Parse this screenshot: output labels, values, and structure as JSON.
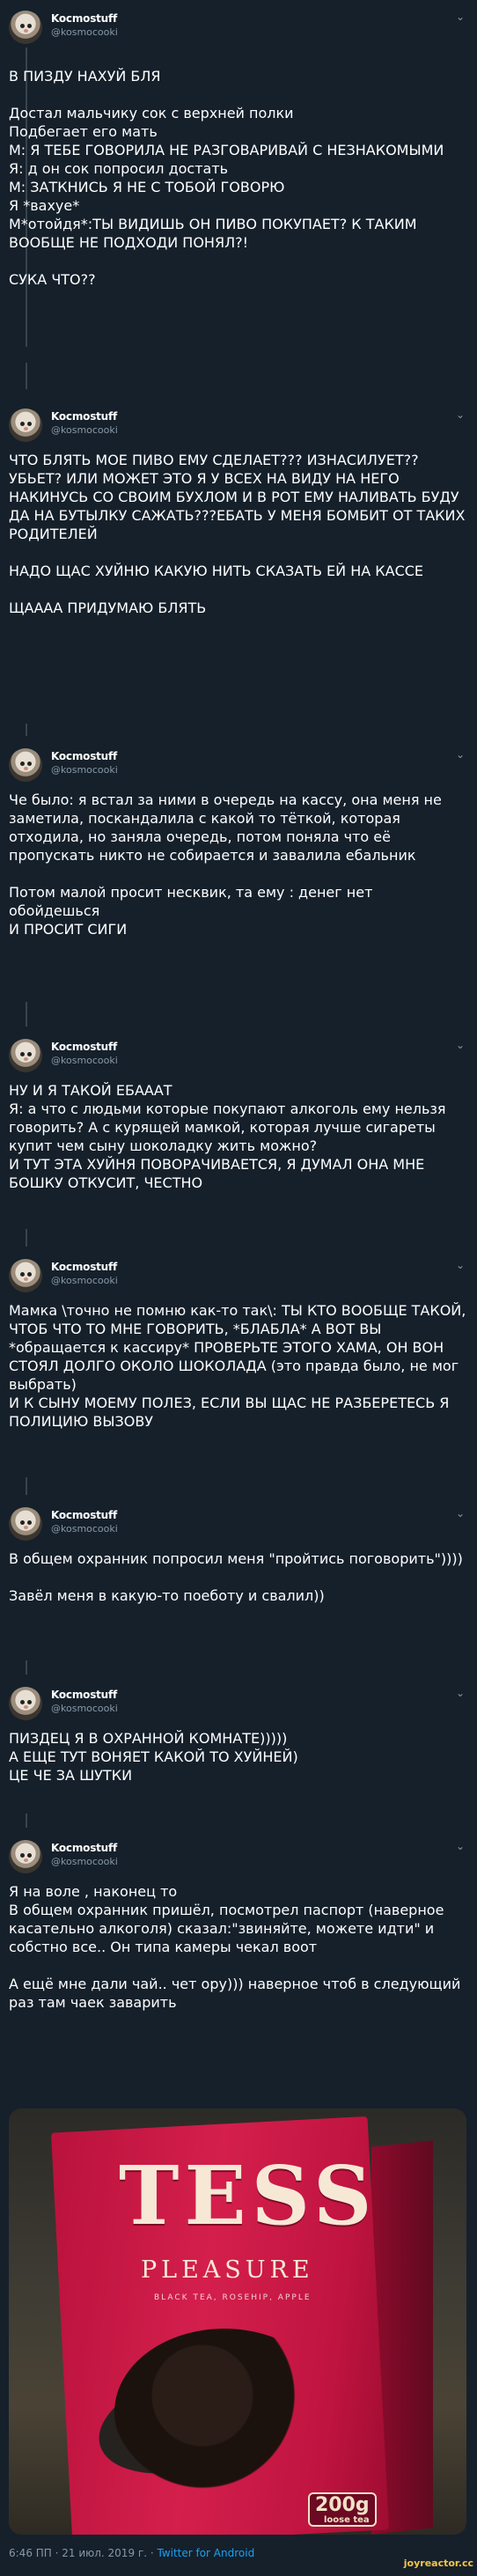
{
  "user": {
    "name": "Kocmostuff",
    "handle": "@kosmocooki"
  },
  "tweets": [
    {
      "lines": [
        "В ПИЗДУ НАХУЙ БЛЯ",
        "",
        "Достал мальчику сок с верхней полки",
        "Подбегает его мать",
        "М: Я ТЕБЕ ГОВОРИЛА НЕ РАЗГОВАРИВАЙ С НЕЗНАКОМЫМИ",
        "Я: д он сок попросил достать",
        "М: ЗАТКНИСЬ Я НЕ С ТОБОЙ ГОВОРЮ",
        "Я *вахуе*",
        "М*отойдя*:ТЫ ВИДИШЬ ОН ПИВО ПОКУПАЕТ? К ТАКИМ ВООБЩЕ НЕ ПОДХОДИ ПОНЯЛ?!",
        "",
        "СУКА ЧТО??"
      ]
    },
    {
      "lines": [
        "ЧТО БЛЯТЬ МОЕ ПИВО ЕМУ СДЕЛАЕТ??? ИЗНАСИЛУЕТ?? УБЬЕТ? ИЛИ МОЖЕТ ЭТО Я У ВСЕХ НА ВИДУ НА НЕГО НАКИНУСЬ СО СВОИМ БУХЛОМ И В РОТ ЕМУ НАЛИВАТЬ БУДУ ДА НА БУТЫЛКУ САЖАТЬ???ЕБАТЬ У МЕНЯ БОМБИТ ОТ ТАКИХ РОДИТЕЛЕЙ",
        "",
        "НАДО ЩАС ХУЙНЮ КАКУЮ НИТЬ СКАЗАТЬ ЕЙ НА КАССЕ",
        "",
        "ЩАААА ПРИДУМАЮ БЛЯТЬ"
      ]
    },
    {
      "lines": [
        "Че было: я встал за ними в очередь на кассу, она меня не заметила, поскандалила с какой то тёткой, которая отходила, но заняла очередь, потом поняла что её пропускать никто не собирается и завалила ебальник",
        "",
        "Потом малой просит несквик, та ему : денег нет обойдешься",
        "И ПРОСИТ СИГИ"
      ]
    },
    {
      "lines": [
        "НУ И Я ТАКОЙ ЕБАААТ",
        "Я: а что с людьми которые покупают алкоголь ему нельзя говорить? А с курящей мамкой, которая лучше сигареты купит чем сыну шоколадку жить можно?",
        "И ТУТ ЭТА ХУЙНЯ ПОВОРАЧИВАЕТСЯ, Я ДУМАЛ ОНА МНЕ БОШКУ ОТКУСИТ, ЧЕСТНО"
      ]
    },
    {
      "lines": [
        "Мамка \\точно не помню как-то так\\: ТЫ КТО ВООБЩЕ ТАКОЙ, ЧТОБ ЧТО ТО МНЕ ГОВОРИТЬ, *БЛАБЛА* А ВОТ ВЫ *обращается к кассиру* ПРОВЕРЬТЕ ЭТОГО ХАМА, ОН ВОН СТОЯЛ ДОЛГО ОКОЛО ШОКОЛАДА (это правда было, не мог выбрать)",
        "И К СЫНУ МОЕМУ ПОЛЕЗ, ЕСЛИ ВЫ ЩАС НЕ РАЗБЕРЕТЕСЬ Я ПОЛИЦИЮ ВЫЗОВУ"
      ]
    },
    {
      "lines": [
        "В общем охранник попросил меня \"пройтись поговорить\"))))",
        "",
        "Завёл меня в какую-то поеботу и свалил))"
      ]
    },
    {
      "lines": [
        "ПИЗДЕЦ Я В ОХРАННОЙ КОМНАТЕ)))))",
        "А ЕЩЕ ТУТ ВОНЯЕТ КАКОЙ ТО ХУЙНЕЙ)",
        "ЦЕ ЧЕ ЗА ШУТКИ"
      ]
    },
    {
      "lines": [
        "Я на воле , наконец то",
        "В общем охранник пришёл, посмотрел паспорт (наверное касательно алкоголя) сказал:\"звиняйте, можете идти\" и собстно все.. Он типа камеры чекал воот",
        "",
        "А ещё мне дали чай.. чет ору))) наверное чтоб в следующий раз там чаек заварить"
      ]
    }
  ],
  "photo": {
    "brand": "TESS",
    "sub": "PLEASURE",
    "tagline": "BLACK TEA, ROSEHIP, APPLE",
    "weight": "200g",
    "weight_unit": "loose tea"
  },
  "footer": {
    "meta": "6:46 ПП · 21 июл. 2019 г. · ",
    "source": "Twitter for Android"
  },
  "watermark": "joyreactor.cc"
}
